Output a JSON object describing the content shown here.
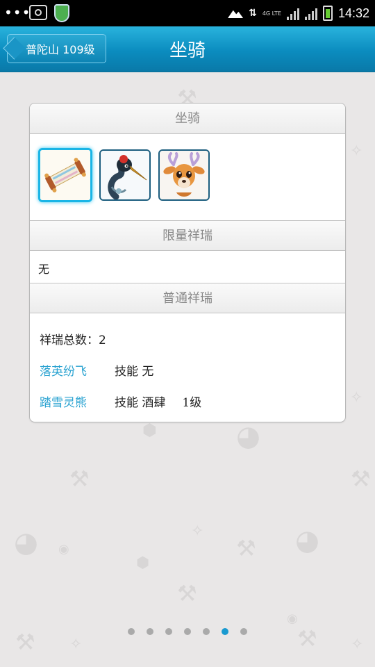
{
  "status_bar": {
    "overflow": "•••",
    "network": "4G LTE",
    "time": "14:32"
  },
  "header": {
    "back_label": "普陀山 109级",
    "title": "坐骑"
  },
  "card": {
    "mounts_section_title": "坐骑",
    "mounts": [
      {
        "icon": "scroll-icon",
        "selected": true
      },
      {
        "icon": "crane-icon",
        "selected": false
      },
      {
        "icon": "deer-icon",
        "selected": false
      }
    ],
    "limited_section_title": "限量祥瑞",
    "limited_value": "无",
    "normal_section_title": "普通祥瑞",
    "total_label": "祥瑞总数：",
    "total_value": "2",
    "items": [
      {
        "name": "落英纷飞",
        "skill": "技能 无",
        "level": ""
      },
      {
        "name": "踏雪灵熊",
        "skill": "技能 酒肆",
        "level": "1级"
      }
    ]
  },
  "pager": {
    "count": 7,
    "active_index": 5
  },
  "colors": {
    "header_blue": "#0b8cbf",
    "link_blue": "#2ba3d1",
    "active_dot": "#1a9ad0"
  }
}
